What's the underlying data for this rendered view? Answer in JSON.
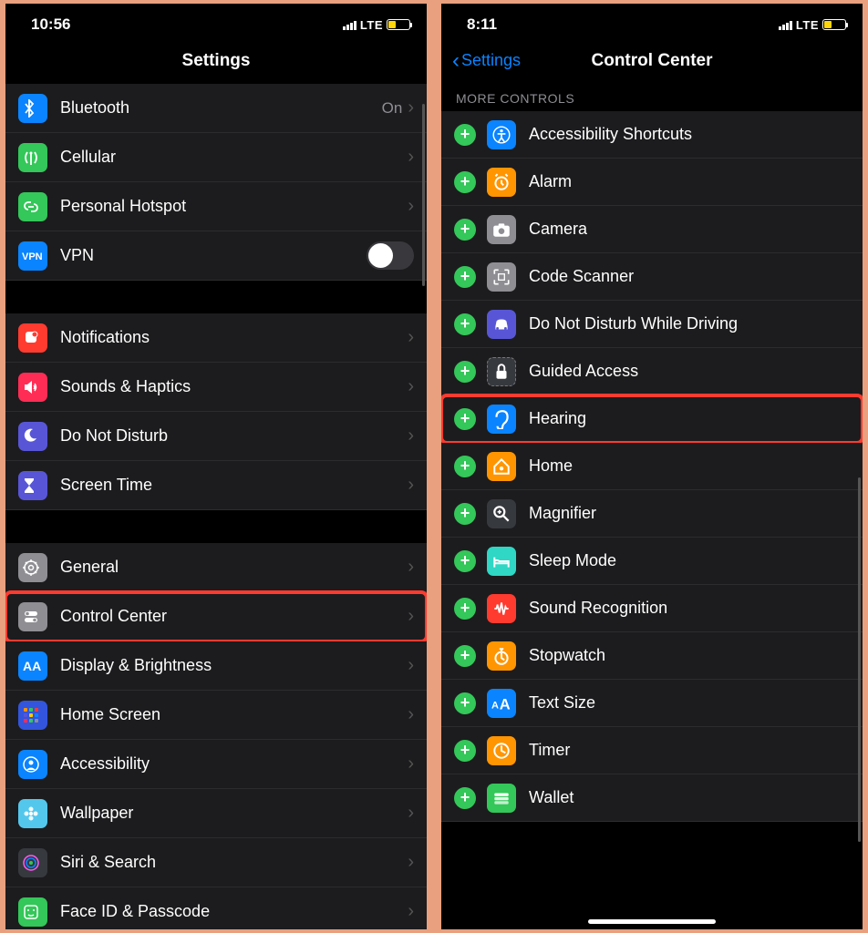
{
  "left": {
    "time": "10:56",
    "network": "LTE",
    "title": "Settings",
    "group1": [
      {
        "label": "Bluetooth",
        "value": "On",
        "color": "#0a84ff",
        "icon": "bluetooth"
      },
      {
        "label": "Cellular",
        "color": "#34c759",
        "icon": "antenna"
      },
      {
        "label": "Personal Hotspot",
        "color": "#34c759",
        "icon": "link"
      },
      {
        "label": "VPN",
        "color": "#0a84ff",
        "icon": "vpn",
        "toggle": true
      }
    ],
    "group2": [
      {
        "label": "Notifications",
        "color": "#ff3b30",
        "icon": "bell"
      },
      {
        "label": "Sounds & Haptics",
        "color": "#ff2d55",
        "icon": "speaker"
      },
      {
        "label": "Do Not Disturb",
        "color": "#5856d6",
        "icon": "moon"
      },
      {
        "label": "Screen Time",
        "color": "#5856d6",
        "icon": "hourglass"
      }
    ],
    "group3": [
      {
        "label": "General",
        "color": "#8e8e93",
        "icon": "gear"
      },
      {
        "label": "Control Center",
        "color": "#8e8e93",
        "icon": "switches",
        "highlight": true
      },
      {
        "label": "Display & Brightness",
        "color": "#0a84ff",
        "icon": "aa"
      },
      {
        "label": "Home Screen",
        "color": "#3355dd",
        "icon": "grid"
      },
      {
        "label": "Accessibility",
        "color": "#0a84ff",
        "icon": "person"
      },
      {
        "label": "Wallpaper",
        "color": "#54c7ec",
        "icon": "flower"
      },
      {
        "label": "Siri & Search",
        "color": "#36393e",
        "icon": "siri"
      },
      {
        "label": "Face ID & Passcode",
        "color": "#34c759",
        "icon": "face"
      }
    ]
  },
  "right": {
    "time": "8:11",
    "network": "LTE",
    "title": "Control Center",
    "back": "Settings",
    "section": "MORE CONTROLS",
    "items": [
      {
        "label": "Accessibility Shortcuts",
        "color": "#0a84ff",
        "icon": "access"
      },
      {
        "label": "Alarm",
        "color": "#ff9500",
        "icon": "alarm"
      },
      {
        "label": "Camera",
        "color": "#8e8e93",
        "icon": "camera"
      },
      {
        "label": "Code Scanner",
        "color": "#8e8e93",
        "icon": "qr"
      },
      {
        "label": "Do Not Disturb While Driving",
        "color": "#5856d6",
        "icon": "car"
      },
      {
        "label": "Guided Access",
        "color": "#36393e",
        "icon": "lock"
      },
      {
        "label": "Hearing",
        "color": "#0a84ff",
        "icon": "ear",
        "highlight": true
      },
      {
        "label": "Home",
        "color": "#ff9500",
        "icon": "home"
      },
      {
        "label": "Magnifier",
        "color": "#36393e",
        "icon": "magnify"
      },
      {
        "label": "Sleep Mode",
        "color": "#2fd7c4",
        "icon": "bed"
      },
      {
        "label": "Sound Recognition",
        "color": "#ff3b30",
        "icon": "wave"
      },
      {
        "label": "Stopwatch",
        "color": "#ff9500",
        "icon": "stopwatch"
      },
      {
        "label": "Text Size",
        "color": "#0a84ff",
        "icon": "textsize"
      },
      {
        "label": "Timer",
        "color": "#ff9500",
        "icon": "timer"
      },
      {
        "label": "Wallet",
        "color": "#34c759",
        "icon": "wallet"
      }
    ]
  }
}
